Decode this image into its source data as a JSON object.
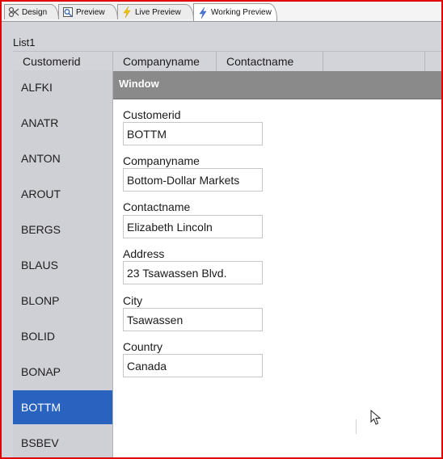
{
  "tabs": [
    {
      "label": "Design",
      "icon": "design-icon",
      "active": false
    },
    {
      "label": "Preview",
      "icon": "preview-icon",
      "active": false
    },
    {
      "label": "Live Preview",
      "icon": "lightning-icon",
      "active": false
    },
    {
      "label": "Working Preview",
      "icon": "lightning-icon",
      "active": true
    }
  ],
  "list": {
    "title": "List1",
    "columns": [
      "Customerid",
      "Companyname",
      "Contactname",
      ""
    ],
    "rows": [
      "ALFKI",
      "ANATR",
      "ANTON",
      "AROUT",
      "BERGS",
      "BLAUS",
      "BLONP",
      "BOLID",
      "BONAP",
      "BOTTM",
      "BSBEV"
    ],
    "selected": "BOTTM"
  },
  "window": {
    "title": "Window",
    "fields": [
      {
        "label": "Customerid",
        "value": "BOTTM"
      },
      {
        "label": "Companyname",
        "value": "Bottom-Dollar Markets"
      },
      {
        "label": "Contactname",
        "value": "Elizabeth Lincoln"
      },
      {
        "label": "Address",
        "value": "23 Tsawassen Blvd."
      },
      {
        "label": "City",
        "value": "Tsawassen"
      },
      {
        "label": "Country",
        "value": "Canada"
      }
    ]
  },
  "colors": {
    "frame_border": "#e00000",
    "selection": "#2a62c0",
    "window_titlebar": "#8a8a8a",
    "workspace": "#d3d3da"
  }
}
